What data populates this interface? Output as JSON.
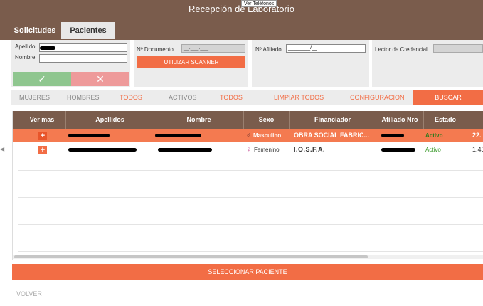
{
  "window": {
    "title": "Recepción de Laboratorio",
    "tooltip": "Ver Teléfonos"
  },
  "tabs": [
    {
      "label": "Solicitudes"
    },
    {
      "label": "Pacientes"
    }
  ],
  "form": {
    "apellido_label": "Apellido",
    "nombre_label": "Nombre",
    "documento_label": "Nº Documento",
    "documento_value": "__.___.___",
    "scanner_label": "UTILIZAR SCANNER",
    "afiliado_label": "Nº Afiliado",
    "afiliado_value": "________/__",
    "credencial_label": "Lector de Credencial",
    "ok_label": "✓",
    "cancel_label": "✕"
  },
  "filters": {
    "mujeres": "MUJERES",
    "hombres": "HOMBRES",
    "todos_sexo": "TODOS",
    "activos": "ACTIVOS",
    "todos_estado": "TODOS",
    "limpiar": "LIMPIAR TODOS",
    "configuracion": "CONFIGURACION",
    "buscar": "BUSCAR"
  },
  "grid": {
    "columns": [
      "Ver mas",
      "Apellidos",
      "Nombre",
      "Sexo",
      "Financiador",
      "Afiliado Nro",
      "Estado"
    ],
    "rows": [
      {
        "plus": "+",
        "sexo_icon": "♂",
        "sexo": "Masculino",
        "financiador": "OBRA SOCIAL FABRIC...",
        "estado": "Activo",
        "extra": "22.",
        "selected": true
      },
      {
        "plus": "+",
        "sexo_icon": "♀",
        "sexo": "Femenino",
        "financiador": "I.O.S.F.A.",
        "estado": "Activo",
        "extra": "1.45",
        "selected": false
      }
    ]
  },
  "footer": {
    "select_label": "SELECCIONAR PACIENTE",
    "volver_label": "VOLVER"
  },
  "colors": {
    "brown": "#7a5c4c",
    "accent": "#f26d45",
    "active_green": "#3a9a2a"
  }
}
